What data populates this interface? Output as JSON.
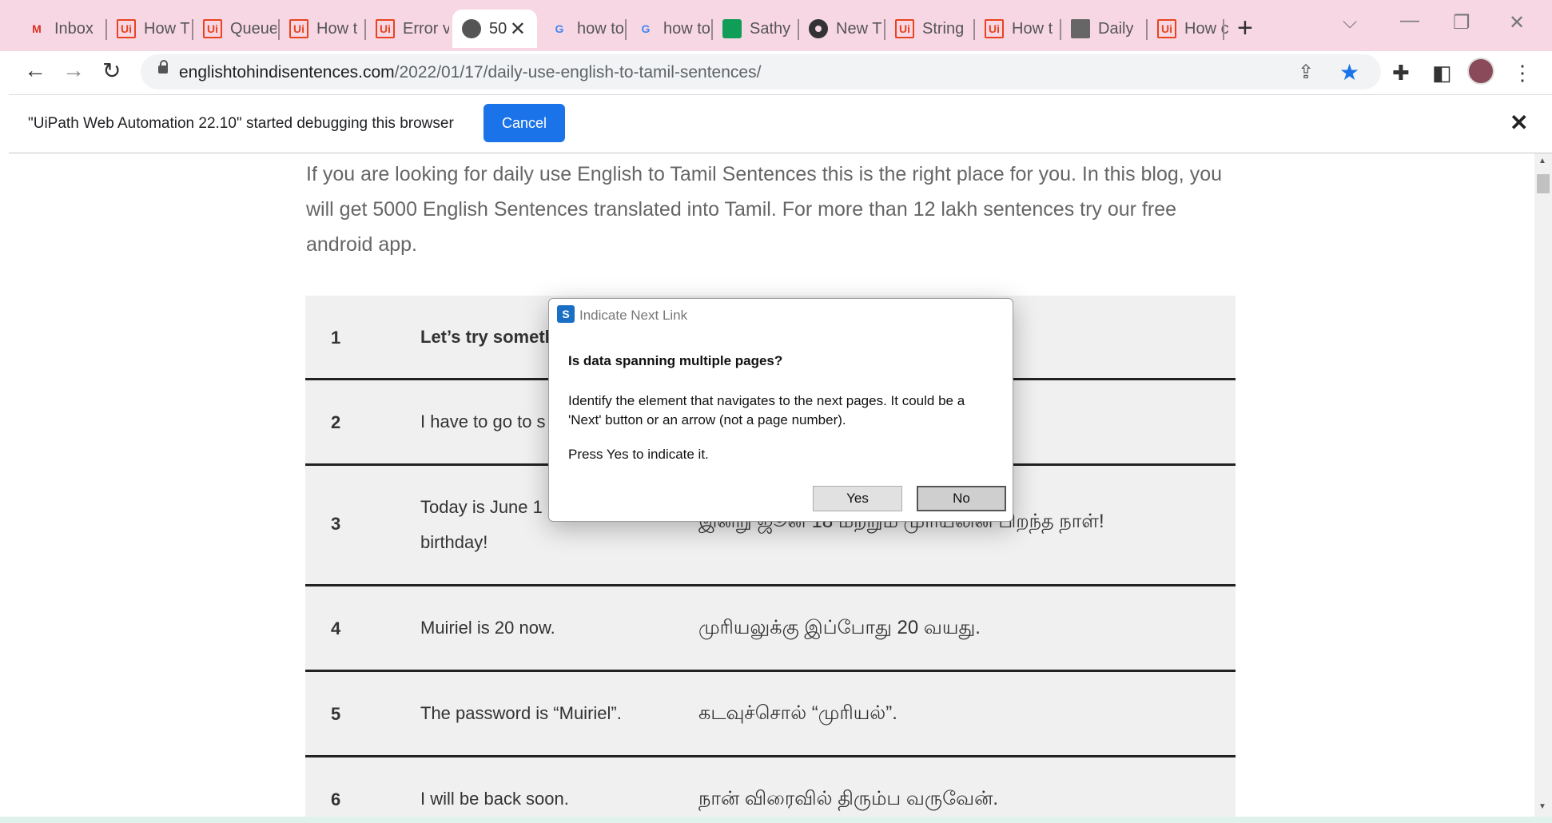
{
  "tabs": [
    {
      "title": "Inbox",
      "icon": "gmail-icon"
    },
    {
      "title": "How T",
      "icon": "uipath-icon"
    },
    {
      "title": "Queue",
      "icon": "uipath-icon"
    },
    {
      "title": "How t",
      "icon": "uipath-icon"
    },
    {
      "title": "Error v",
      "icon": "uipath-icon"
    },
    {
      "title": "50",
      "icon": "globe-icon",
      "active": true
    },
    {
      "title": "how to",
      "icon": "google-icon"
    },
    {
      "title": "how to",
      "icon": "google-icon"
    },
    {
      "title": "Sathy",
      "icon": "chat-icon"
    },
    {
      "title": "New T",
      "icon": "chrome-icon"
    },
    {
      "title": "String",
      "icon": "uipath-icon"
    },
    {
      "title": "How t",
      "icon": "uipath-icon"
    },
    {
      "title": "Daily",
      "icon": "video-icon"
    },
    {
      "title": "How c",
      "icon": "uipath-icon"
    }
  ],
  "address": {
    "domain": "englishtohindisentences.com",
    "path": "/2022/01/17/daily-use-english-to-tamil-sentences/"
  },
  "infobar": {
    "message": "\"UiPath Web Automation 22.10\" started debugging this browser",
    "cancel_label": "Cancel"
  },
  "page": {
    "intro": "If you are looking for daily use English to Tamil Sentences this is the right place for you. In this blog, you will get 5000 English Sentences translated into Tamil. For more than 12 lakh sentences try our free android app."
  },
  "table_rows": [
    {
      "num": "1",
      "en": "Let’s try someth",
      "ta": ""
    },
    {
      "num": "2",
      "en": "I have to go to s",
      "ta": ""
    },
    {
      "num": "3",
      "en": "Today is June 1 Muiriel’s birthday!",
      "ta": "இன்று ஜூன் 18 மற்றும் முரியலின் பிறந்த நாள்!"
    },
    {
      "num": "4",
      "en": "Muiriel is 20 now.",
      "ta": "முரியலுக்கு இப்போது 20 வயது."
    },
    {
      "num": "5",
      "en": "The password is “Muiriel”.",
      "ta": "கடவுச்சொல் “முரியல்”."
    },
    {
      "num": "6",
      "en": "I will be back soon.",
      "ta": "நான் விரைவில் திரும்ப வருவேன்."
    }
  ],
  "dialog": {
    "title": "Indicate Next Link",
    "heading": "Is data spanning multiple pages?",
    "body": "Identify the element that navigates to the next pages. It could be a 'Next' button or an arrow (not a page number).",
    "press": "Press Yes to indicate it.",
    "yes_label": "Yes",
    "no_label": "No"
  },
  "colors": {
    "tabstrip": "#f8d7e4",
    "accent": "#1a73e8",
    "uipath": "#e8431d"
  }
}
